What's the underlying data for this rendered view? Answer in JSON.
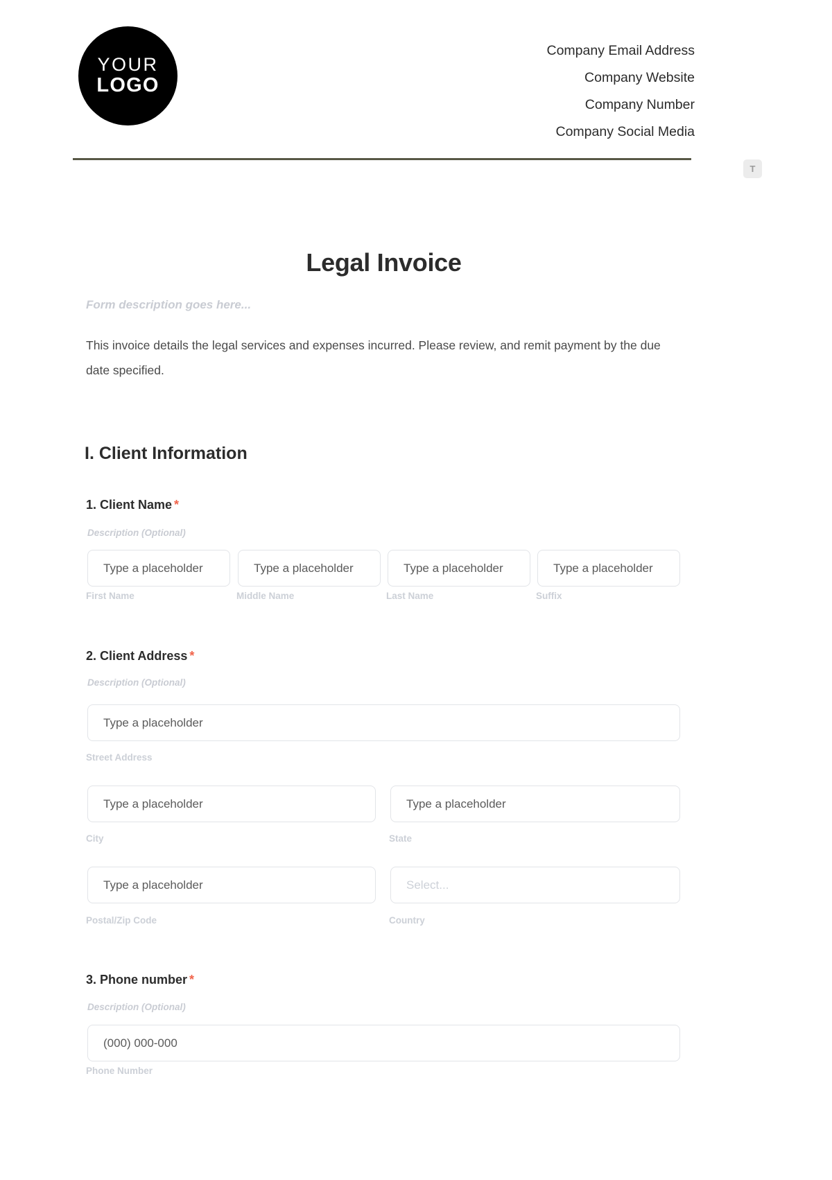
{
  "header": {
    "logo": {
      "line1": "YOUR",
      "line2": "LOGO"
    },
    "company_lines": [
      "Company Email Address",
      "Company Website",
      "Company Number",
      "Company Social Media"
    ]
  },
  "text_tool_badge": {
    "label": "T"
  },
  "form": {
    "title": "Legal Invoice",
    "description_placeholder": "Form description goes here...",
    "intro": "This invoice details the legal services and expenses incurred. Please review, and remit payment by the due date specified.",
    "section_title": "I. Client Information",
    "description_optional": "Description (Optional)",
    "questions": [
      {
        "label": "1. Client Name",
        "required_mark": "*",
        "description": "Description (Optional)",
        "fields": [
          {
            "placeholder": "Type a placeholder",
            "sub_label": "First Name"
          },
          {
            "placeholder": "Type a placeholder",
            "sub_label": "Middle Name"
          },
          {
            "placeholder": "Type a placeholder",
            "sub_label": "Last Name"
          },
          {
            "placeholder": "Type a placeholder",
            "sub_label": "Suffix"
          }
        ]
      },
      {
        "label": "2. Client Address",
        "required_mark": "*",
        "description": "Description (Optional)",
        "fields": [
          {
            "placeholder": "Type a placeholder",
            "sub_label": "Street Address"
          },
          {
            "placeholder": "Type a placeholder",
            "sub_label": "City"
          },
          {
            "placeholder": "Type a placeholder",
            "sub_label": "State"
          },
          {
            "placeholder": "Type a placeholder",
            "sub_label": "Postal/Zip Code"
          },
          {
            "placeholder": "Select...",
            "sub_label": "Country"
          }
        ]
      },
      {
        "label": "3. Phone number",
        "required_mark": "*",
        "description": "Description (Optional)",
        "fields": [
          {
            "placeholder": "(000) 000-000",
            "sub_label": "Phone Number"
          }
        ]
      }
    ]
  },
  "colors": {
    "accent_divider": "#585846",
    "required_star": "#f1644b",
    "logo_background": "#000000",
    "placeholder_gray": "#c9ccd3"
  }
}
